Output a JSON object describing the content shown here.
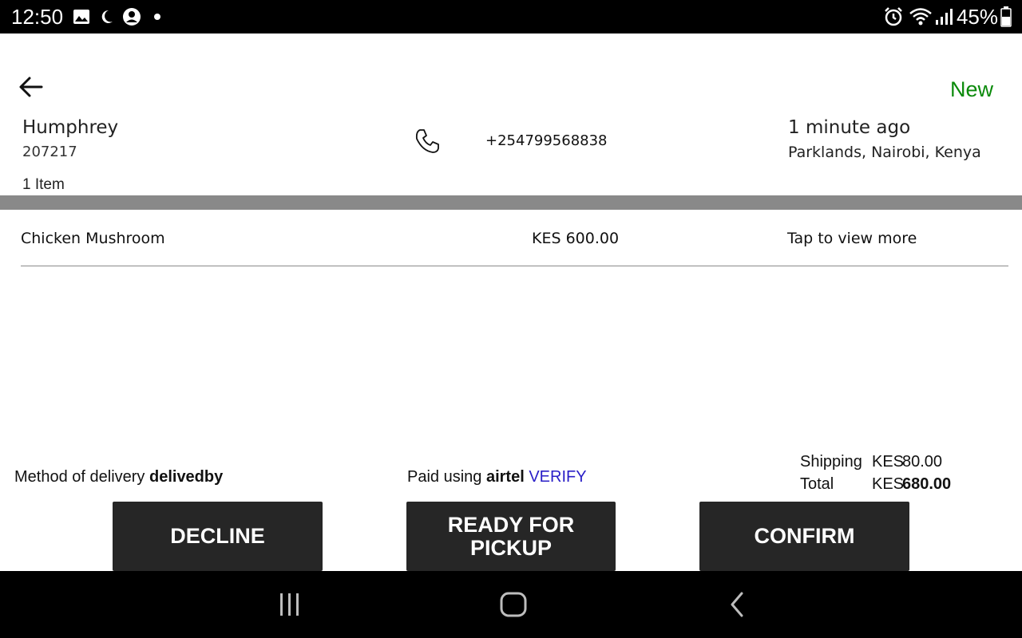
{
  "status_bar": {
    "time": "12:50",
    "battery": "45%",
    "icons": [
      "image-icon",
      "moon-icon",
      "account-icon",
      "dot-icon",
      "alarm-icon",
      "wifi-icon",
      "signal-icon",
      "battery-icon"
    ]
  },
  "order": {
    "status": "New",
    "customer_name": "Humphrey",
    "order_id": "207217",
    "item_count": "1 Item",
    "phone": "+254799568838",
    "time_ago": "1 minute ago",
    "location": "Parklands, Nairobi, Kenya"
  },
  "items": [
    {
      "name": "Chicken Mushroom",
      "price": "KES 600.00",
      "action": "Tap to view more"
    }
  ],
  "footer": {
    "delivery_label": "Method of delivery",
    "delivery_value": "delivedby",
    "paid_label": "Paid using",
    "paid_value": "airtel",
    "verify_label": "VERIFY",
    "shipping_label": "Shipping",
    "shipping_currency": "KES",
    "shipping_value": "80.00",
    "total_label": "Total",
    "total_currency": "KES",
    "total_value": "680.00"
  },
  "buttons": {
    "decline": "DECLINE",
    "ready_line1": "READY FOR",
    "ready_line2": "PICKUP",
    "confirm": "CONFIRM"
  },
  "colors": {
    "status_new": "#0a8a0a",
    "verify_link": "#2a1fc7",
    "button_bg": "#262626",
    "divider": "#898989"
  }
}
